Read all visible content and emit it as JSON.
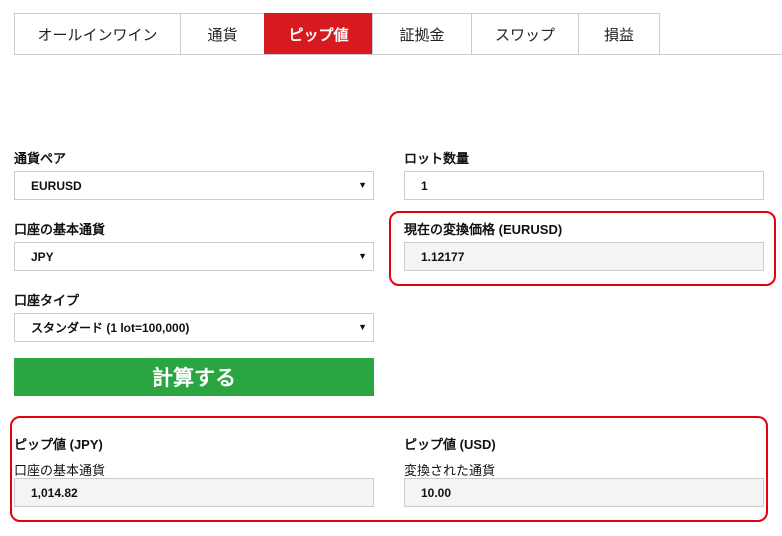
{
  "tabs": [
    {
      "label": "オールインワイン",
      "active": false
    },
    {
      "label": "通貨",
      "active": false
    },
    {
      "label": "ピップ値",
      "active": true
    },
    {
      "label": "証拠金",
      "active": false
    },
    {
      "label": "スワップ",
      "active": false
    },
    {
      "label": "損益",
      "active": false
    }
  ],
  "form": {
    "currency_pair": {
      "label": "通貨ペア",
      "value": "EURUSD"
    },
    "lot_size": {
      "label": "ロット数量",
      "value": "1"
    },
    "base_currency": {
      "label": "口座の基本通貨",
      "value": "JPY"
    },
    "conversion_rate": {
      "label": "現在の変換価格 (EURUSD)",
      "value": "1.12177"
    },
    "account_type": {
      "label": "口座タイプ",
      "value": "スタンダード (1 lot=100,000)"
    },
    "calculate_label": "計算する"
  },
  "results": {
    "jpy": {
      "title": "ピップ値 (JPY)",
      "sub": "口座の基本通貨",
      "value": "1,014.82"
    },
    "usd": {
      "title": "ピップ値 (USD)",
      "sub": "変換された通貨",
      "value": "10.00"
    }
  },
  "colors": {
    "accent": "#d71920",
    "button": "#2ba540",
    "highlight": "#e3000f"
  }
}
